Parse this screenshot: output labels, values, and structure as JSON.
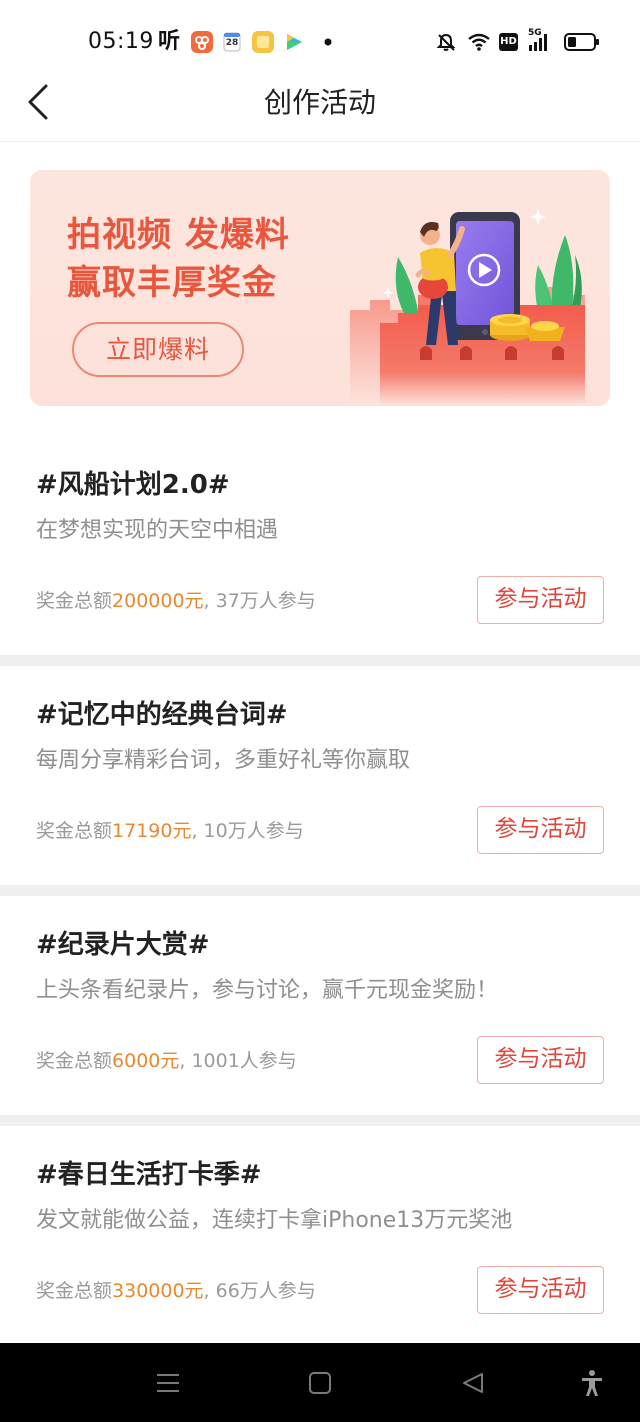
{
  "status_bar": {
    "time": "05:19",
    "app_glyph": "听",
    "calendar_day": "28",
    "hd_label": "HD",
    "network_label": "5G",
    "icons": [
      "ting-app-icon",
      "orange-app-icon",
      "calendar-icon",
      "notes-app-icon",
      "video-app-icon",
      "more-dot-icon",
      "bell-off-icon",
      "wifi-icon",
      "hd-icon",
      "signal-icon",
      "battery-icon"
    ]
  },
  "header": {
    "title": "创作活动",
    "back_icon": "chevron-left-icon"
  },
  "banner": {
    "line1": "拍视频 发爆料",
    "line2": "赢取丰厚奖金",
    "button_label": "立即爆料"
  },
  "activities": [
    {
      "title": "#风船计划2.0#",
      "subtitle": "在梦想实现的天空中相遇",
      "prize_label": "奖金总额",
      "prize_amount": "200000元",
      "participants": ", 37万人参与",
      "button_label": "参与活动"
    },
    {
      "title": "#记忆中的经典台词#",
      "subtitle": "每周分享精彩台词，多重好礼等你赢取",
      "prize_label": "奖金总额",
      "prize_amount": "17190元",
      "participants": ", 10万人参与",
      "button_label": "参与活动"
    },
    {
      "title": "#纪录片大赏#",
      "subtitle": "上头条看纪录片，参与讨论，赢千元现金奖励！",
      "prize_label": "奖金总额",
      "prize_amount": "6000元",
      "participants": ", 1001人参与",
      "button_label": "参与活动"
    },
    {
      "title": "#春日生活打卡季#",
      "subtitle": "发文就能做公益，连续打卡拿iPhone13万元奖池",
      "prize_label": "奖金总额",
      "prize_amount": "330000元",
      "participants": ", 66万人参与",
      "button_label": "参与活动"
    }
  ],
  "nav_bar": {
    "icons": [
      "menu-icon",
      "home-square-icon",
      "back-triangle-icon",
      "accessibility-icon"
    ]
  },
  "colors": {
    "banner_text": "#e8573d",
    "banner_bg": "#fde4dd",
    "join_button_text": "#e0463a",
    "join_button_border": "#f1aea6",
    "prize_amount": "#e8892f",
    "subtitle_text": "#8f8f8f"
  }
}
